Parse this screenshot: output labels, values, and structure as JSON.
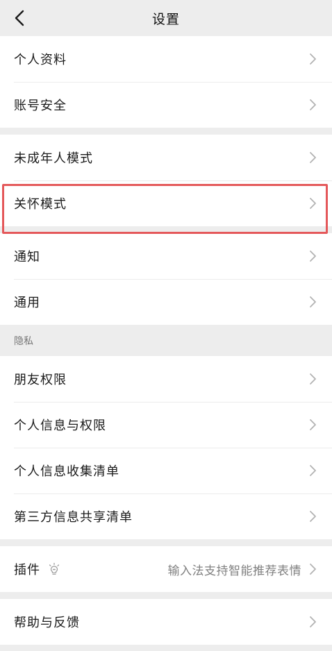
{
  "header": {
    "title": "设置"
  },
  "groups": {
    "account": {
      "items": [
        {
          "label": "个人资料"
        },
        {
          "label": "账号安全"
        }
      ]
    },
    "modes": {
      "items": [
        {
          "label": "未成年人模式"
        },
        {
          "label": "关怀模式"
        }
      ]
    },
    "general": {
      "items": [
        {
          "label": "通知"
        },
        {
          "label": "通用"
        }
      ]
    },
    "privacy": {
      "section_label": "隐私",
      "items": [
        {
          "label": "朋友权限"
        },
        {
          "label": "个人信息与权限"
        },
        {
          "label": "个人信息收集清单"
        },
        {
          "label": "第三方信息共享清单"
        }
      ]
    },
    "plugins": {
      "items": [
        {
          "label": "插件",
          "value": "输入法支持智能推荐表情"
        }
      ]
    },
    "help": {
      "items": [
        {
          "label": "帮助与反馈"
        }
      ]
    }
  },
  "colors": {
    "background": "#ededed",
    "row_background": "#ffffff",
    "highlight_border": "#e4585a",
    "chevron": "#b2b2b2"
  },
  "icons": {
    "back": "chevron-left-icon",
    "row_arrow": "chevron-right-icon",
    "plugin_hint": "lightbulb-icon"
  }
}
